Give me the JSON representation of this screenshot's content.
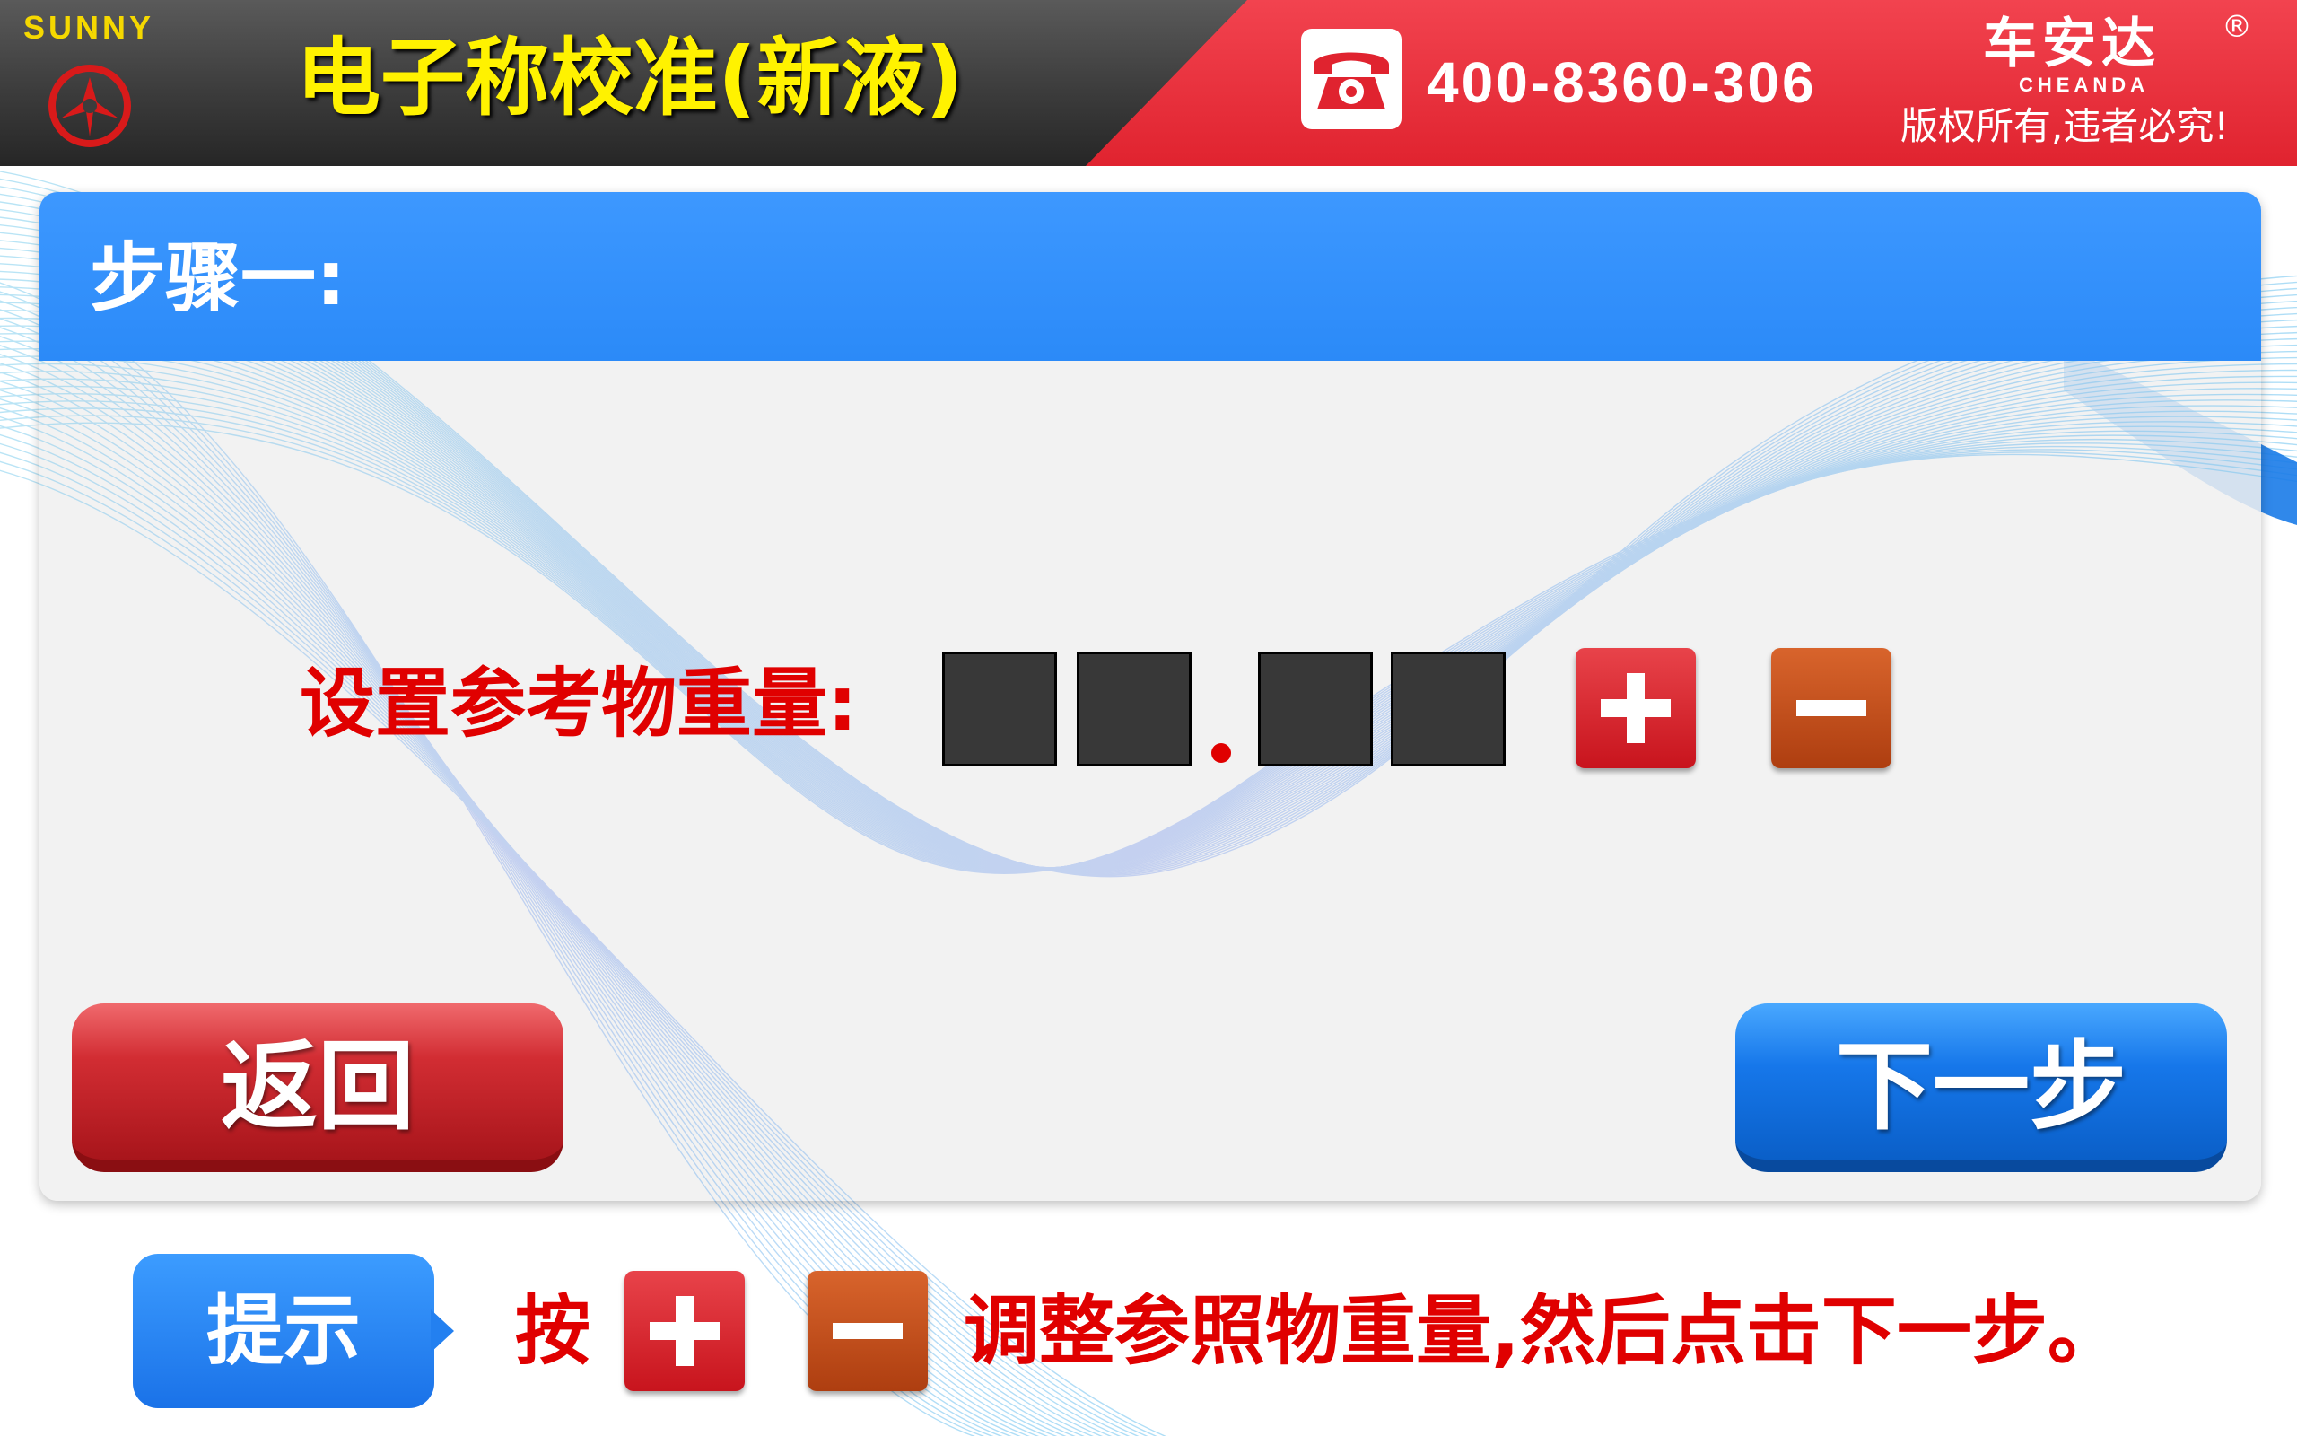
{
  "header": {
    "brand": "SUNNY",
    "title": "电子称校准(新液)",
    "phone": "400-8360-306",
    "company_cn": "车安达",
    "company_reg": "®",
    "company_en": "CHEANDA",
    "copyright": "版权所有,违者必究!"
  },
  "colors": {
    "header_dark": "#3c3c3c",
    "header_red": "#e0232f",
    "title_yellow": "#fff200",
    "panel_blue": "#2b8af8",
    "label_red": "#e00000",
    "digit_box": "#383838"
  },
  "step": {
    "title": "步骤一:"
  },
  "weight_setting": {
    "label": "设置参考物重量:",
    "digits": [
      "",
      "",
      "",
      ""
    ],
    "plus_icon": "plus-icon",
    "minus_icon": "minus-icon"
  },
  "buttons": {
    "back": "返回",
    "next": "下一步"
  },
  "hint": {
    "badge": "提示",
    "text_before": "按",
    "text_after": "调整参照物重量,然后点击下一步。"
  }
}
